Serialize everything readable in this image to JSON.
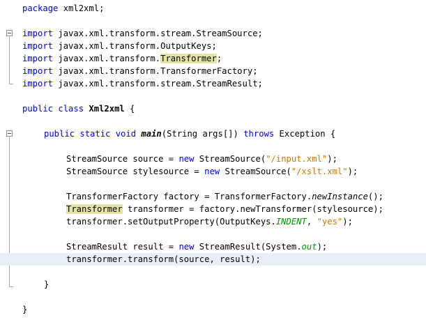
{
  "lines": [
    [
      "package",
      " xml2xml;"
    ],
    [
      "import",
      " javax.xml.transform.stream.StreamSource;"
    ],
    [
      "import",
      " javax.xml.transform.OutputKeys;"
    ],
    [
      "import",
      " javax.xml.transform.",
      "Transformer",
      ";"
    ],
    [
      "import",
      " javax.xml.transform.TransformerFactory;"
    ],
    [
      "import",
      " javax.xml.transform.stream.StreamResult;"
    ],
    [
      "public class",
      " ",
      "Xml2xml",
      " {"
    ],
    [
      "public static void",
      " ",
      "main",
      "(String args[]) ",
      "throws",
      " Exception {"
    ],
    [
      "StreamSource source = ",
      "new",
      " StreamSource(",
      "\"/input.xml\"",
      ");"
    ],
    [
      "StreamSource stylesource = ",
      "new",
      " StreamSource(",
      "\"/xslt.xml\"",
      ");"
    ],
    [
      "TransformerFactory factory = TransformerFactory.",
      "newInstance",
      "();"
    ],
    [
      "Transformer",
      " transformer = factory.newTransformer(stylesource);"
    ],
    [
      "transformer.setOutputProperty(OutputKeys.",
      "INDENT",
      ", ",
      "\"yes\"",
      ");"
    ],
    [
      "StreamResult result = ",
      "new",
      " StreamResult(System.",
      "out",
      ");"
    ],
    [
      "transformer.transform(source, result);"
    ],
    [
      "}"
    ],
    [
      "}"
    ]
  ]
}
